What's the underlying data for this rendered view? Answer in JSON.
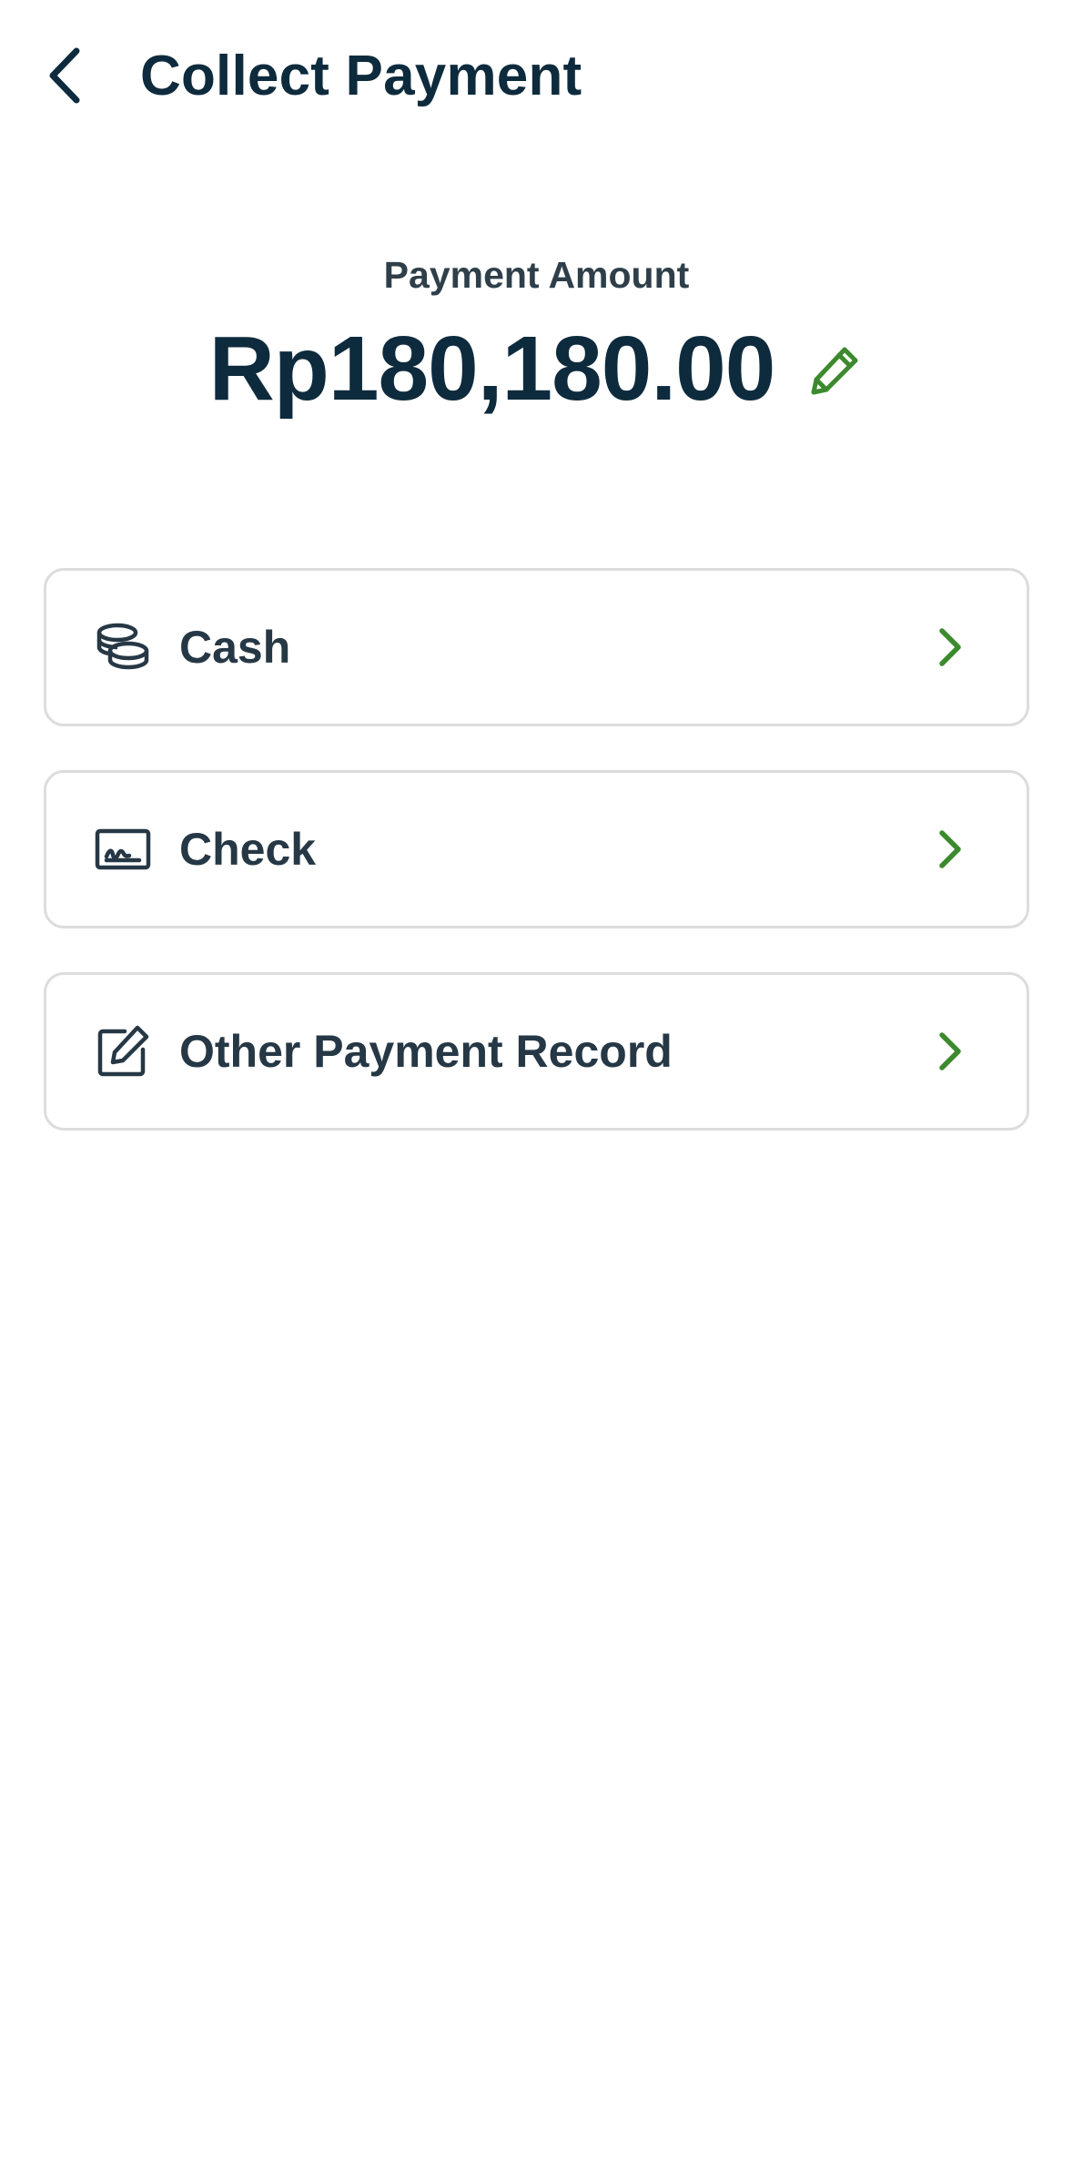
{
  "header": {
    "title": "Collect Payment",
    "back_icon": "chevron-left-icon"
  },
  "amount": {
    "label": "Payment Amount",
    "value": "Rp180,180.00",
    "edit_icon": "pencil-icon"
  },
  "payment_options": [
    {
      "label": "Cash",
      "icon": "coins-icon"
    },
    {
      "label": "Check",
      "icon": "check-document-icon"
    },
    {
      "label": "Other Payment Record",
      "icon": "edit-square-icon"
    }
  ],
  "colors": {
    "text_primary": "#0e2b3d",
    "text_secondary": "#2f3f4a",
    "accent_green": "#3c8a2e",
    "border": "#dcdcdc",
    "background": "#ffffff"
  }
}
